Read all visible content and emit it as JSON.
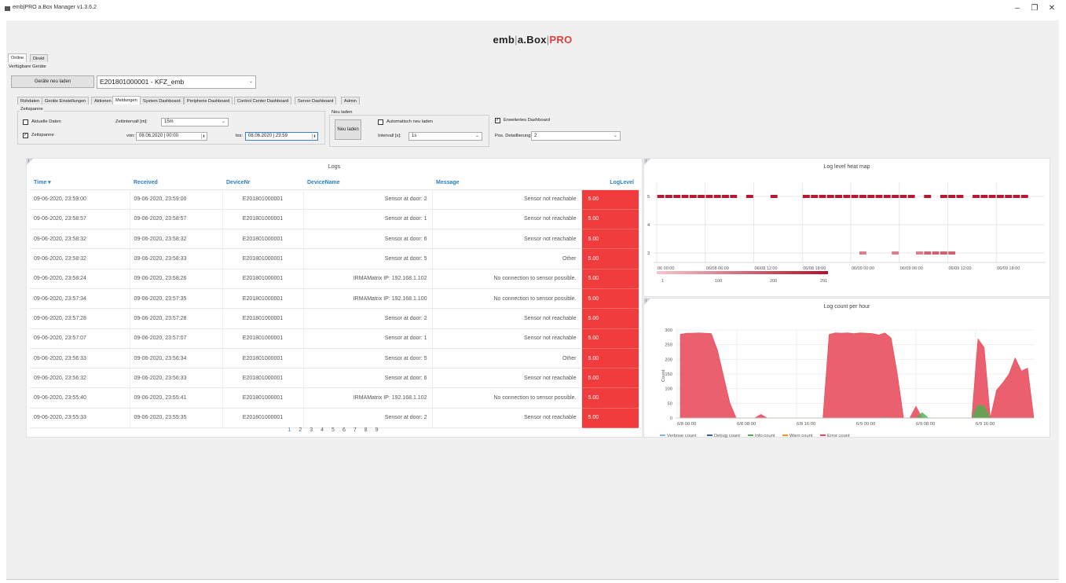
{
  "window": {
    "title": "emb|PRO a.Box Manager v1.3.6.2",
    "minimize": "–",
    "restore": "❐",
    "close": "✕"
  },
  "brand": {
    "part1": "emb",
    "sep1": "|",
    "part2": "a.Box",
    "sep2": "|",
    "part3": "PRO"
  },
  "top_tabs": [
    {
      "label": "Online"
    },
    {
      "label": "Direkt"
    }
  ],
  "devices": {
    "group_label": "Verfügbare Geräte",
    "reload_button": "Geräte neu laden",
    "selected": "E201801000001 - KFZ_emb"
  },
  "main_tabs": [
    {
      "label": "Rohdaten"
    },
    {
      "label": "Geräte Einstellungen"
    },
    {
      "label": "Aktionen"
    },
    {
      "label": "Meldungen"
    },
    {
      "label": "System Dashboard"
    },
    {
      "label": "Peripherie Dashboard"
    },
    {
      "label": "Control Center Dashboard"
    },
    {
      "label": "Server Dashboard"
    },
    {
      "label": "Admin"
    }
  ],
  "zeitspanne": {
    "group_label": "Zeitspanne",
    "aktuelle_daten": "Aktuelle Daten",
    "aktuelle_checked": false,
    "zeitspanne": "Zeitspanne",
    "zeitspanne_checked": true,
    "intervall_label": "Zeitintervall [m]:",
    "intervall_value": "15m",
    "von_label": "von:",
    "von_value": "08.06.2020 | 00:00",
    "bis_label": "bis:",
    "bis_value": "08.06.2020 | 23:59"
  },
  "neu_laden": {
    "group_label": "Neu laden",
    "button": "Neu laden",
    "auto_label": "Automatisch neu laden",
    "auto_checked": false,
    "intervall_label": "Intervall [s]:",
    "intervall_value": "1s"
  },
  "dashboard": {
    "erweitert_label": "Erweitertes Dashboard",
    "erweitert_checked": true,
    "detail_label": "Pos. Detaillierung:",
    "detail_value": "2"
  },
  "logs": {
    "title": "Logs",
    "info": "i",
    "columns": [
      "Time ▾",
      "Received",
      "DeviceNr",
      "DeviceName",
      "Message",
      "LogLevel"
    ],
    "rows": [
      [
        "09-06-2020, 23:59:00",
        "09-06-2020, 23:59:00",
        "E201801000001",
        "Sensor at door: 2",
        "Sensor not reachable",
        "5.00"
      ],
      [
        "09-06-2020, 23:58:57",
        "09-06-2020, 23:58:57",
        "E201801000001",
        "Sensor at door: 1",
        "Sensor not reachable",
        "5.00"
      ],
      [
        "09-06-2020, 23:58:32",
        "09-06-2020, 23:58:32",
        "E201801000001",
        "Sensor at door: 6",
        "Sensor not reachable",
        "5.00"
      ],
      [
        "09-06-2020, 23:58:32",
        "09-06-2020, 23:58:33",
        "E201801000001",
        "Sensor at door: 5",
        "Other",
        "5.00"
      ],
      [
        "09-06-2020, 23:58:24",
        "09-06-2020, 23:58:26",
        "E201801000001",
        "IRMAMatrix IP: 192.168.1.102",
        "No connection to sensor possible.",
        "5.00"
      ],
      [
        "09-06-2020, 23:57:34",
        "09-06-2020, 23:57:35",
        "E201801000001",
        "IRMAMatrix IP: 192.168.1.100",
        "No connection to sensor possible.",
        "5.00"
      ],
      [
        "09-06-2020, 23:57:28",
        "09-06-2020, 23:57:28",
        "E201801000001",
        "Sensor at door: 2",
        "Sensor not reachable",
        "5.00"
      ],
      [
        "09-06-2020, 23:57:07",
        "09-06-2020, 23:57:07",
        "E201801000001",
        "Sensor at door: 1",
        "Sensor not reachable",
        "5.00"
      ],
      [
        "09-06-2020, 23:56:33",
        "09-06-2020, 23:56:34",
        "E201801000001",
        "Sensor at door: 5",
        "Other",
        "5.00"
      ],
      [
        "09-06-2020, 23:56:32",
        "09-06-2020, 23:56:33",
        "E201801000001",
        "Sensor at door: 6",
        "Sensor not reachable",
        "5.00"
      ],
      [
        "09-06-2020, 23:55:40",
        "09-06-2020, 23:55:41",
        "E201801000001",
        "IRMAMatrix IP: 192.168.1.102",
        "No connection to sensor possible.",
        "5.00"
      ],
      [
        "09-06-2020, 23:55:33",
        "09-06-2020, 23:55:35",
        "E201801000001",
        "Sensor at door: 2",
        "Sensor not reachable",
        "5.00"
      ]
    ],
    "pages": [
      "1",
      "2",
      "3",
      "4",
      "5",
      "6",
      "7",
      "8",
      "9"
    ],
    "current_page": "1",
    "loglevel_color": "#f03c3c"
  },
  "chart_data": [
    {
      "type": "heatmap",
      "title": "Log level heat map",
      "info": "i",
      "x_ticks": [
        "06 00:00",
        "06/08 06:00",
        "06/08 12:00",
        "06/08 18:00",
        "06/09 00:00",
        "06/09 06:00",
        "06/09 12:00",
        "06/09 18:00"
      ],
      "y_ticks": [
        "5",
        "4",
        "3"
      ],
      "scale_ticks": [
        "1",
        "100",
        "200",
        "291"
      ],
      "color_low": "#f5c7cf",
      "color_high": "#b3102a",
      "rows": [
        {
          "level": 5,
          "bins": [
            [
              0,
              9
            ],
            [
              11,
              11
            ],
            [
              14,
              14
            ],
            [
              18,
              31
            ],
            [
              33,
              33
            ],
            [
              35,
              37
            ],
            [
              39,
              45
            ]
          ]
        },
        {
          "level": 3,
          "bins": [
            [
              25,
              25
            ],
            [
              29,
              29
            ],
            [
              32,
              36
            ]
          ]
        }
      ],
      "bin_count": 48
    },
    {
      "type": "area",
      "title": "Log count per hour",
      "info": "i",
      "ylabel": "Count",
      "ylim": [
        0,
        300
      ],
      "y_ticks": [
        "0",
        "50",
        "100",
        "150",
        "200",
        "250",
        "300"
      ],
      "x_ticks": [
        "6/8 00:00",
        "6/8 08:00",
        "6/8 16:00",
        "6/9 00:00",
        "6/9 08:00",
        "6/9 16:00"
      ],
      "series": [
        {
          "name": "Verbose count",
          "color": "#7cb5ec",
          "values": []
        },
        {
          "name": "Debug count",
          "color": "#2f5fa8",
          "values": []
        },
        {
          "name": "Info count",
          "color": "#4caf50",
          "values": [
            0,
            0,
            0,
            0,
            0,
            0,
            0,
            0,
            0,
            0,
            0,
            0,
            0,
            0,
            0,
            0,
            0,
            0,
            0,
            0,
            0,
            0,
            0,
            0,
            0,
            0,
            0,
            0,
            0,
            0,
            0,
            0,
            0,
            2,
            0,
            0,
            0,
            0,
            0,
            18,
            0,
            0,
            0,
            0,
            0,
            0,
            0,
            0,
            45,
            40,
            0,
            0,
            0,
            0,
            0,
            0,
            0,
            0
          ]
        },
        {
          "name": "Warn count",
          "color": "#f7941d",
          "values": []
        },
        {
          "name": "Error count",
          "color": "#e84455",
          "values": [
            285,
            289,
            289,
            290,
            289,
            288,
            230,
            140,
            50,
            0,
            0,
            0,
            0,
            12,
            0,
            0,
            0,
            0,
            0,
            0,
            0,
            0,
            0,
            0,
            285,
            290,
            289,
            290,
            288,
            290,
            289,
            288,
            283,
            290,
            273,
            150,
            0,
            0,
            40,
            0,
            0,
            0,
            0,
            0,
            0,
            0,
            0,
            0,
            270,
            240,
            0,
            95,
            120,
            150,
            205,
            160,
            170,
            0
          ]
        }
      ],
      "x_points": 58
    }
  ]
}
